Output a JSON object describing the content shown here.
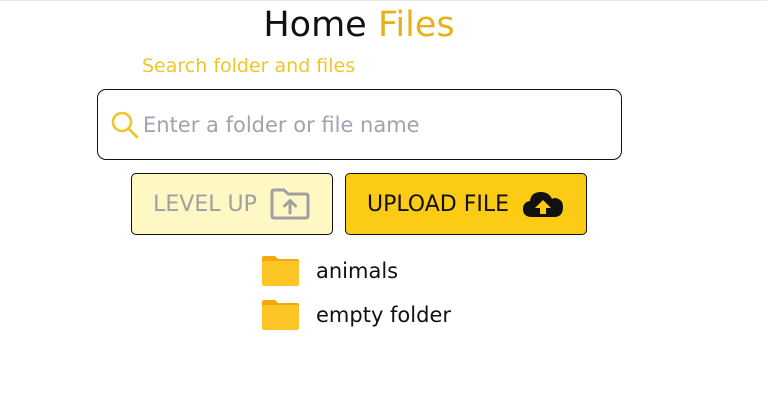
{
  "header": {
    "title_main": "Home",
    "title_accent": "Files",
    "subtitle": "Search folder and files"
  },
  "search": {
    "placeholder": "Enter a folder or file name",
    "value": "",
    "icon": "search-icon"
  },
  "actions": {
    "level_up": {
      "label": "LEVEL UP",
      "icon": "folder-up-icon"
    },
    "upload": {
      "label": "UPLOAD FILE",
      "icon": "cloud-upload-icon"
    }
  },
  "items": [
    {
      "name": "animals",
      "type": "folder"
    },
    {
      "name": "empty folder",
      "type": "folder"
    }
  ],
  "colors": {
    "accent": "#e7b219",
    "subtitle": "#f0c52a",
    "upload_bg": "#fccb15",
    "level_up_bg": "#fff8c5",
    "folder": "#fbbe1f"
  }
}
